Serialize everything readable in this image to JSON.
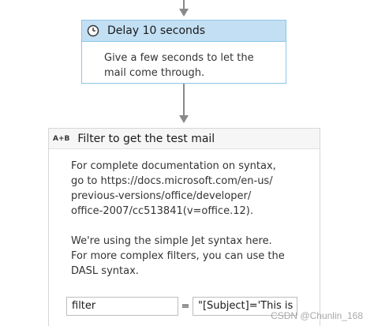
{
  "delay_activity": {
    "title": "Delay 10 seconds",
    "icon": "clock-icon",
    "annotation": "Give a few seconds to let the\nmail come through."
  },
  "filter_activity": {
    "title": "Filter to get the test mail",
    "icon": "ab-assign-icon",
    "icon_text": "A+B",
    "annotation": "For complete documentation on syntax,\ngo to https://docs.microsoft.com/en-us/\nprevious-versions/office/developer/\noffice-2007/cc513841(v=office.12).\n\nWe're using the simple Jet syntax here.\nFor more complex filters, you can use the\nDASL syntax.",
    "assign_to": "filter",
    "equals": "=",
    "assign_value": "\"[Subject]='This is"
  },
  "watermark": "CSDN @Chunlin_168",
  "colors": {
    "delay_header": "#c3dff3",
    "delay_border": "#8ec5e6",
    "connector": "#8a8a8a"
  }
}
